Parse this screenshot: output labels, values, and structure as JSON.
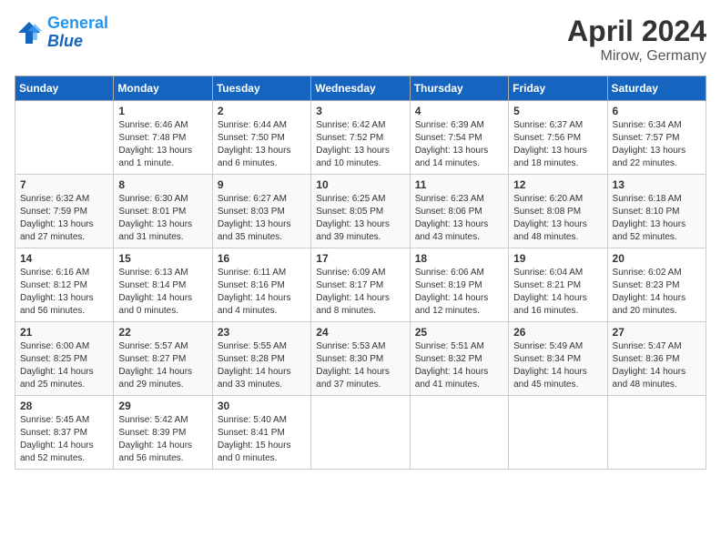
{
  "header": {
    "logo_line1": "General",
    "logo_line2": "Blue",
    "title": "April 2024",
    "subtitle": "Mirow, Germany"
  },
  "weekdays": [
    "Sunday",
    "Monday",
    "Tuesday",
    "Wednesday",
    "Thursday",
    "Friday",
    "Saturday"
  ],
  "weeks": [
    [
      {
        "day": null
      },
      {
        "day": "1",
        "sunrise": "6:46 AM",
        "sunset": "7:48 PM",
        "daylight": "13 hours and 1 minute."
      },
      {
        "day": "2",
        "sunrise": "6:44 AM",
        "sunset": "7:50 PM",
        "daylight": "13 hours and 6 minutes."
      },
      {
        "day": "3",
        "sunrise": "6:42 AM",
        "sunset": "7:52 PM",
        "daylight": "13 hours and 10 minutes."
      },
      {
        "day": "4",
        "sunrise": "6:39 AM",
        "sunset": "7:54 PM",
        "daylight": "13 hours and 14 minutes."
      },
      {
        "day": "5",
        "sunrise": "6:37 AM",
        "sunset": "7:56 PM",
        "daylight": "13 hours and 18 minutes."
      },
      {
        "day": "6",
        "sunrise": "6:34 AM",
        "sunset": "7:57 PM",
        "daylight": "13 hours and 22 minutes."
      }
    ],
    [
      {
        "day": "7",
        "sunrise": "6:32 AM",
        "sunset": "7:59 PM",
        "daylight": "13 hours and 27 minutes."
      },
      {
        "day": "8",
        "sunrise": "6:30 AM",
        "sunset": "8:01 PM",
        "daylight": "13 hours and 31 minutes."
      },
      {
        "day": "9",
        "sunrise": "6:27 AM",
        "sunset": "8:03 PM",
        "daylight": "13 hours and 35 minutes."
      },
      {
        "day": "10",
        "sunrise": "6:25 AM",
        "sunset": "8:05 PM",
        "daylight": "13 hours and 39 minutes."
      },
      {
        "day": "11",
        "sunrise": "6:23 AM",
        "sunset": "8:06 PM",
        "daylight": "13 hours and 43 minutes."
      },
      {
        "day": "12",
        "sunrise": "6:20 AM",
        "sunset": "8:08 PM",
        "daylight": "13 hours and 48 minutes."
      },
      {
        "day": "13",
        "sunrise": "6:18 AM",
        "sunset": "8:10 PM",
        "daylight": "13 hours and 52 minutes."
      }
    ],
    [
      {
        "day": "14",
        "sunrise": "6:16 AM",
        "sunset": "8:12 PM",
        "daylight": "13 hours and 56 minutes."
      },
      {
        "day": "15",
        "sunrise": "6:13 AM",
        "sunset": "8:14 PM",
        "daylight": "14 hours and 0 minutes."
      },
      {
        "day": "16",
        "sunrise": "6:11 AM",
        "sunset": "8:16 PM",
        "daylight": "14 hours and 4 minutes."
      },
      {
        "day": "17",
        "sunrise": "6:09 AM",
        "sunset": "8:17 PM",
        "daylight": "14 hours and 8 minutes."
      },
      {
        "day": "18",
        "sunrise": "6:06 AM",
        "sunset": "8:19 PM",
        "daylight": "14 hours and 12 minutes."
      },
      {
        "day": "19",
        "sunrise": "6:04 AM",
        "sunset": "8:21 PM",
        "daylight": "14 hours and 16 minutes."
      },
      {
        "day": "20",
        "sunrise": "6:02 AM",
        "sunset": "8:23 PM",
        "daylight": "14 hours and 20 minutes."
      }
    ],
    [
      {
        "day": "21",
        "sunrise": "6:00 AM",
        "sunset": "8:25 PM",
        "daylight": "14 hours and 25 minutes."
      },
      {
        "day": "22",
        "sunrise": "5:57 AM",
        "sunset": "8:27 PM",
        "daylight": "14 hours and 29 minutes."
      },
      {
        "day": "23",
        "sunrise": "5:55 AM",
        "sunset": "8:28 PM",
        "daylight": "14 hours and 33 minutes."
      },
      {
        "day": "24",
        "sunrise": "5:53 AM",
        "sunset": "8:30 PM",
        "daylight": "14 hours and 37 minutes."
      },
      {
        "day": "25",
        "sunrise": "5:51 AM",
        "sunset": "8:32 PM",
        "daylight": "14 hours and 41 minutes."
      },
      {
        "day": "26",
        "sunrise": "5:49 AM",
        "sunset": "8:34 PM",
        "daylight": "14 hours and 45 minutes."
      },
      {
        "day": "27",
        "sunrise": "5:47 AM",
        "sunset": "8:36 PM",
        "daylight": "14 hours and 48 minutes."
      }
    ],
    [
      {
        "day": "28",
        "sunrise": "5:45 AM",
        "sunset": "8:37 PM",
        "daylight": "14 hours and 52 minutes."
      },
      {
        "day": "29",
        "sunrise": "5:42 AM",
        "sunset": "8:39 PM",
        "daylight": "14 hours and 56 minutes."
      },
      {
        "day": "30",
        "sunrise": "5:40 AM",
        "sunset": "8:41 PM",
        "daylight": "15 hours and 0 minutes."
      },
      {
        "day": null
      },
      {
        "day": null
      },
      {
        "day": null
      },
      {
        "day": null
      }
    ]
  ]
}
